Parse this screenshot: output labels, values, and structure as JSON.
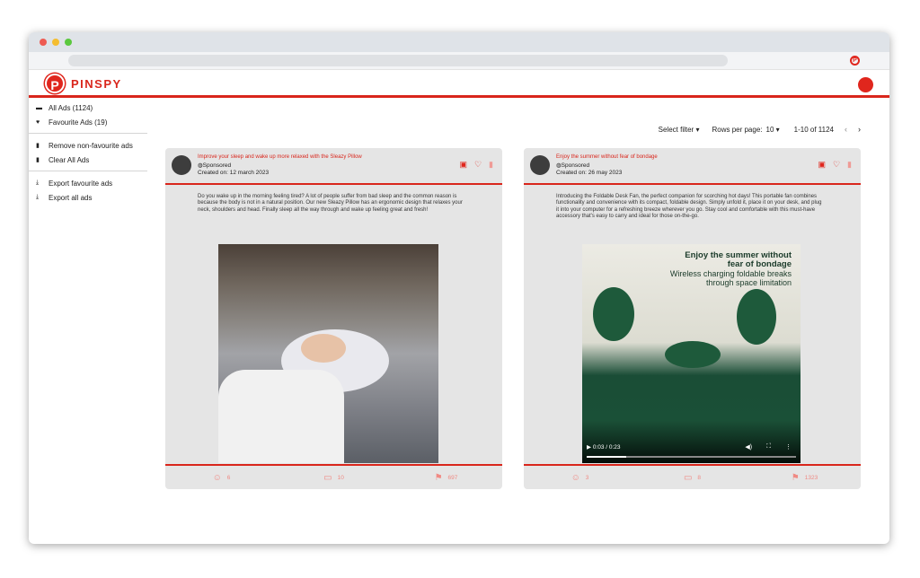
{
  "app": {
    "name": "PINSPY"
  },
  "sidebar": {
    "items": [
      {
        "label": "All Ads (1124)",
        "icon": "ads-icon"
      },
      {
        "label": "Favourite Ads (19)",
        "icon": "heart-icon"
      },
      {
        "label": "Remove non-favourite ads",
        "icon": "trash-icon"
      },
      {
        "label": "Clear All Ads",
        "icon": "trash-icon"
      },
      {
        "label": "Export favourite ads",
        "icon": "download-icon"
      },
      {
        "label": "Export all ads",
        "icon": "download-icon"
      }
    ]
  },
  "toolbar": {
    "select_filter": "Select filter",
    "rows_label": "Rows per page:",
    "rows_value": "10",
    "range": "1-10 of 1124"
  },
  "cards": [
    {
      "title": "Improve your sleep and wake up more relaxed with the Sleazy Pillow",
      "sponsored": "Sponsored",
      "created": "Created on: 12 march 2023",
      "description": "Do you wake up in the morning feeling tired? A lot of people suffer from bad sleep and the common reason is because the body is not in a natural position. Our new Sleazy Pillow has an ergonomic design that relaxes your neck, shoulders and head. Finally sleep all the way through and wake up feeling great and fresh!",
      "stats": {
        "reactions": "6",
        "comments": "10",
        "saves": "697"
      }
    },
    {
      "title": "Enjoy the summer without fear of bondage",
      "sponsored": "Sponsored",
      "created": "Created on: 26 may 2023",
      "description": "Introducing the Foldable Desk Fan, the perfect companion for scorching hot days! This portable fan combines functionality and convenience with its compact, foldable design. Simply unfold it, place it on your desk, and plug it into your computer for a refreshing breeze wherever you go. Stay cool and comfortable with this must-have accessory that's easy to carry and ideal for those on-the-go.",
      "media_text": {
        "line1": "Enjoy the summer without",
        "line2": "fear of bondage",
        "line3": "Wireless charging foldable breaks",
        "line4": "through space limitation"
      },
      "video_time": "0:03 / 0:23",
      "stats": {
        "reactions": "3",
        "comments": "8",
        "saves": "1323"
      }
    }
  ],
  "colors": {
    "accent": "#d9261c"
  }
}
